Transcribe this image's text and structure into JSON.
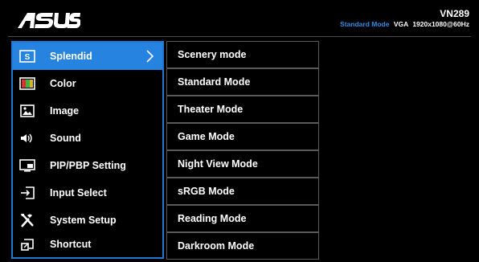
{
  "brand": {
    "logo_text": "/ISUS"
  },
  "header": {
    "model": "VN289",
    "status_mode": "Standard Mode",
    "status_input": "VGA",
    "status_resolution": "1920x1080@60Hz"
  },
  "colors": {
    "accent": "#2683e0",
    "border": "#1f78d1",
    "status_mode": "#2f8ee8"
  },
  "menu": {
    "items": [
      {
        "label": "Splendid",
        "icon": "splendid-s-icon",
        "active": true
      },
      {
        "label": "Color",
        "icon": "color-icon"
      },
      {
        "label": "Image",
        "icon": "image-icon"
      },
      {
        "label": "Sound",
        "icon": "speaker-icon"
      },
      {
        "label": "PIP/PBP Setting",
        "icon": "pip-icon"
      },
      {
        "label": "Input Select",
        "icon": "input-select-icon"
      },
      {
        "label": "System Setup",
        "icon": "tools-icon"
      },
      {
        "label": "Shortcut",
        "icon": "shortcut-icon"
      }
    ]
  },
  "submenu": {
    "items": [
      {
        "label": "Scenery mode"
      },
      {
        "label": "Standard Mode"
      },
      {
        "label": "Theater Mode"
      },
      {
        "label": "Game Mode"
      },
      {
        "label": "Night View Mode"
      },
      {
        "label": "sRGB Mode"
      },
      {
        "label": "Reading Mode"
      },
      {
        "label": "Darkroom Mode"
      }
    ]
  }
}
